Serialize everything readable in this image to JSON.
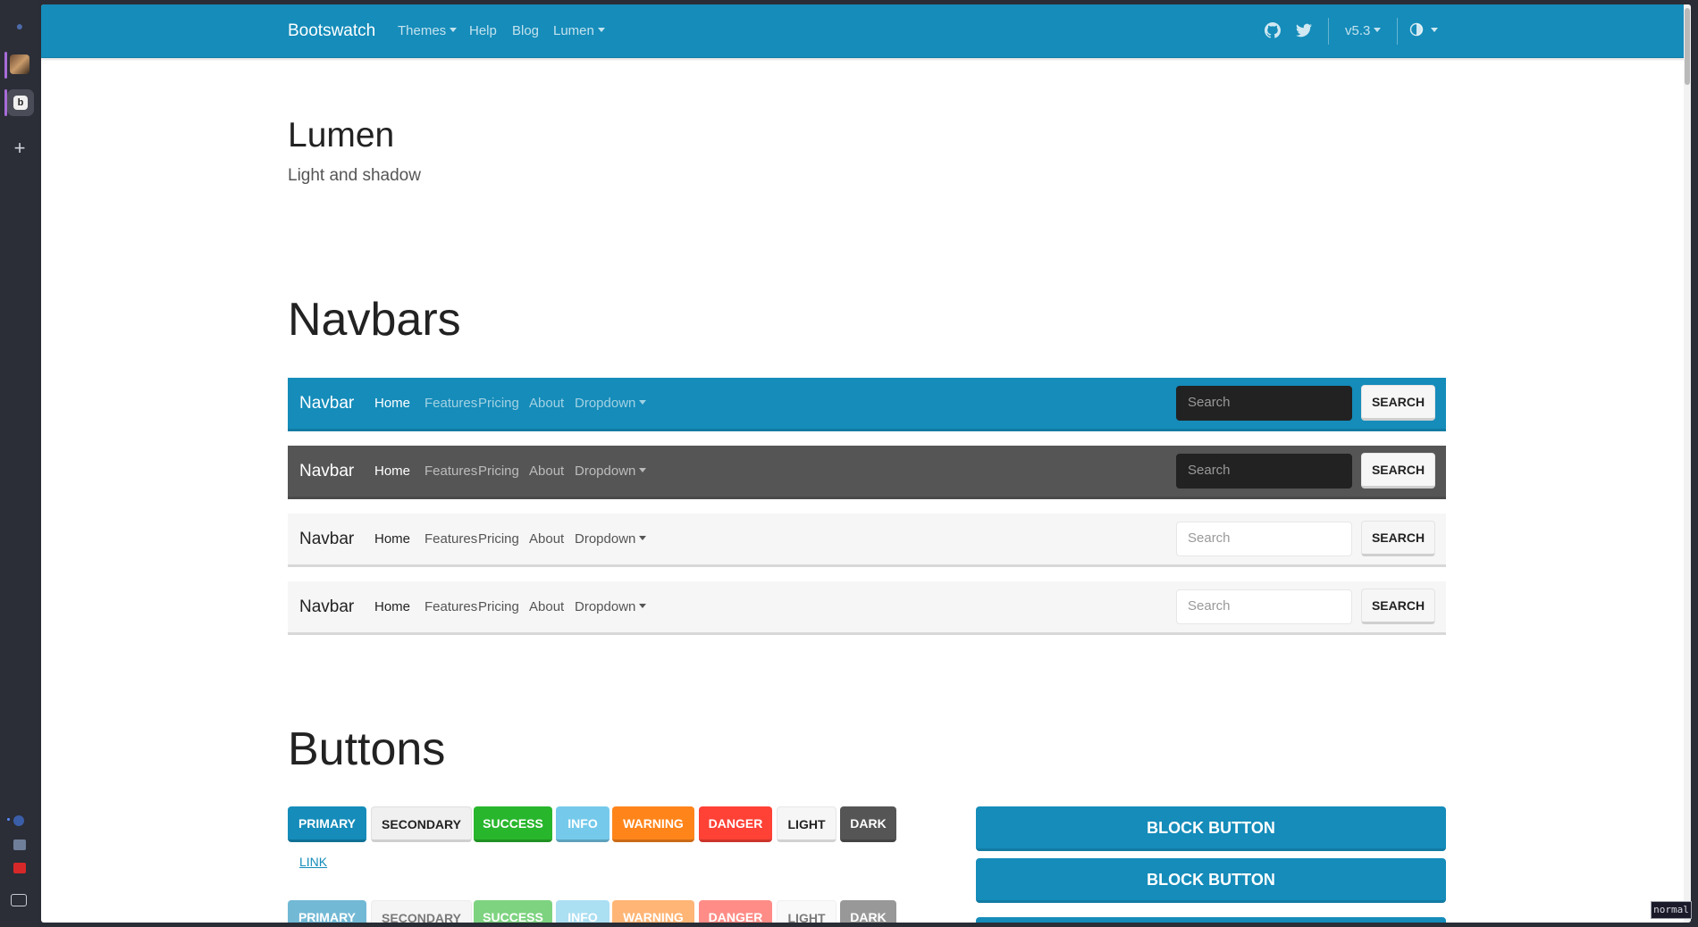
{
  "topnav": {
    "brand": "Bootswatch",
    "links": [
      "Themes",
      "Help",
      "Blog",
      "Lumen"
    ],
    "version": "v5.3",
    "icons": [
      "github-icon",
      "twitter-icon",
      "theme-toggle-icon"
    ]
  },
  "header": {
    "title": "Lumen",
    "lead": "Light and shadow"
  },
  "sections": {
    "navbars": "Navbars",
    "buttons": "Buttons"
  },
  "demo_navbar": {
    "brand": "Navbar",
    "links": [
      "Home",
      "Features",
      "Pricing",
      "About",
      "Dropdown"
    ],
    "search_placeholder": "Search",
    "search_button": "SEARCH"
  },
  "buttons": {
    "labels": [
      "PRIMARY",
      "SECONDARY",
      "SUCCESS",
      "INFO",
      "WARNING",
      "DANGER",
      "LIGHT",
      "DARK"
    ],
    "link": "LINK",
    "block": "BLOCK BUTTON"
  },
  "colors": {
    "primary": "#158cba",
    "success": "#28b62c",
    "info": "#75caeb",
    "warning": "#ff851b",
    "danger": "#ff4136",
    "dark": "#555555"
  },
  "status": {
    "mode": "normal"
  }
}
